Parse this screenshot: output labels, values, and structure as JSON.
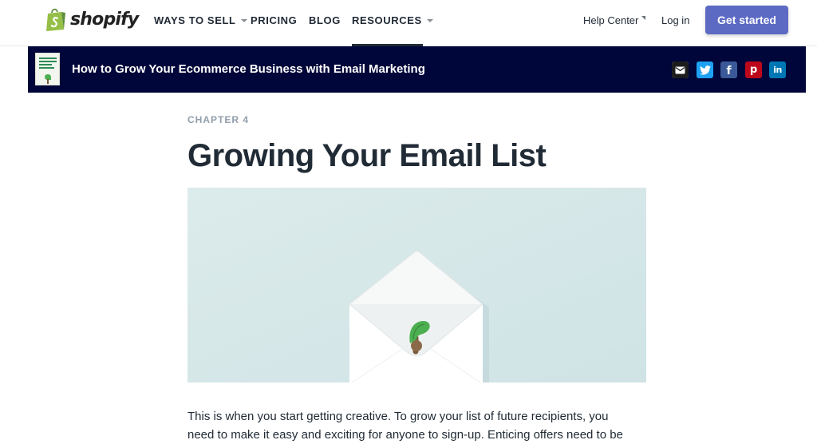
{
  "brand": {
    "name": "shopify",
    "accent": "#5c6ac4",
    "logo_color": "#95bf47"
  },
  "nav": {
    "items": [
      {
        "label": "WAYS TO SELL",
        "has_dropdown": true
      },
      {
        "label": "PRICING",
        "has_dropdown": false
      },
      {
        "label": "BLOG",
        "has_dropdown": false
      },
      {
        "label": "RESOURCES",
        "has_dropdown": true,
        "active": true
      }
    ],
    "help_center": "Help Center",
    "log_in": "Log in",
    "get_started": "Get started"
  },
  "guide_bar": {
    "background": "#000639",
    "title": "How to Grow Your Ecommerce Business with Email Marketing",
    "share_icons": [
      {
        "name": "email-icon",
        "color": "#1c1c1c"
      },
      {
        "name": "twitter-icon",
        "color": "#1da1f2"
      },
      {
        "name": "facebook-icon",
        "color": "#3b5998"
      },
      {
        "name": "pinterest-icon",
        "color": "#bd081c"
      },
      {
        "name": "linkedin-icon",
        "color": "#0077b5"
      }
    ]
  },
  "article": {
    "chapter": "CHAPTER 4",
    "title": "Growing Your Email List",
    "hero_icon": "envelope-with-sprout",
    "body_lines": [
      "This is when you start getting creative. To grow your list of future recipients, you",
      "need to make it easy and exciting for anyone to sign-up. Enticing offers need to be"
    ]
  }
}
